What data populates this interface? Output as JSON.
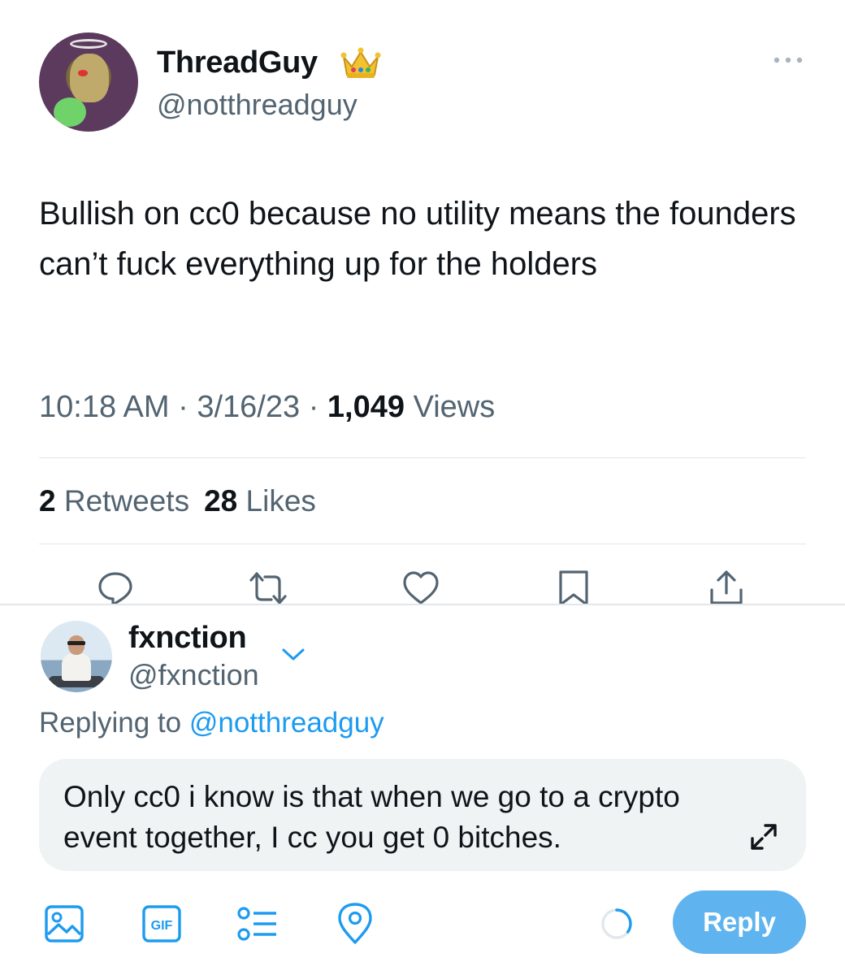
{
  "tweet": {
    "author_name": "ThreadGuy",
    "author_badge_icon": "crown-icon",
    "author_handle": "@notthreadguy",
    "text": "Bullish on cc0 because no utility means the founders can’t fuck everything up for the holders",
    "time": "10:18 AM",
    "sep1": " · ",
    "date": "3/16/23",
    "sep2": " · ",
    "views_count": "1,049",
    "views_label": " Views",
    "retweets_count": "2",
    "retweets_label": " Retweets",
    "likes_count": "28",
    "likes_label": " Likes",
    "actions": [
      "reply-icon",
      "retweet-icon",
      "like-icon",
      "bookmark-icon",
      "share-icon"
    ]
  },
  "reply": {
    "author_name": "fxnction",
    "author_handle": "@fxnction",
    "replying_prefix": "Replying to ",
    "replying_to": "@notthreadguy",
    "draft_text": "Only cc0 i know is that when we go to a crypto event together, I cc you get 0 bitches.",
    "tools": [
      "image-icon",
      "gif-icon",
      "poll-icon",
      "location-icon"
    ],
    "gif_label": "GIF",
    "submit_label": "Reply",
    "char_progress": 0.35
  },
  "colors": {
    "accent": "#1d9bf0",
    "reply_button": "#5fb3ef",
    "secondary_text": "#536471",
    "composer_bg": "#eff3f4"
  }
}
